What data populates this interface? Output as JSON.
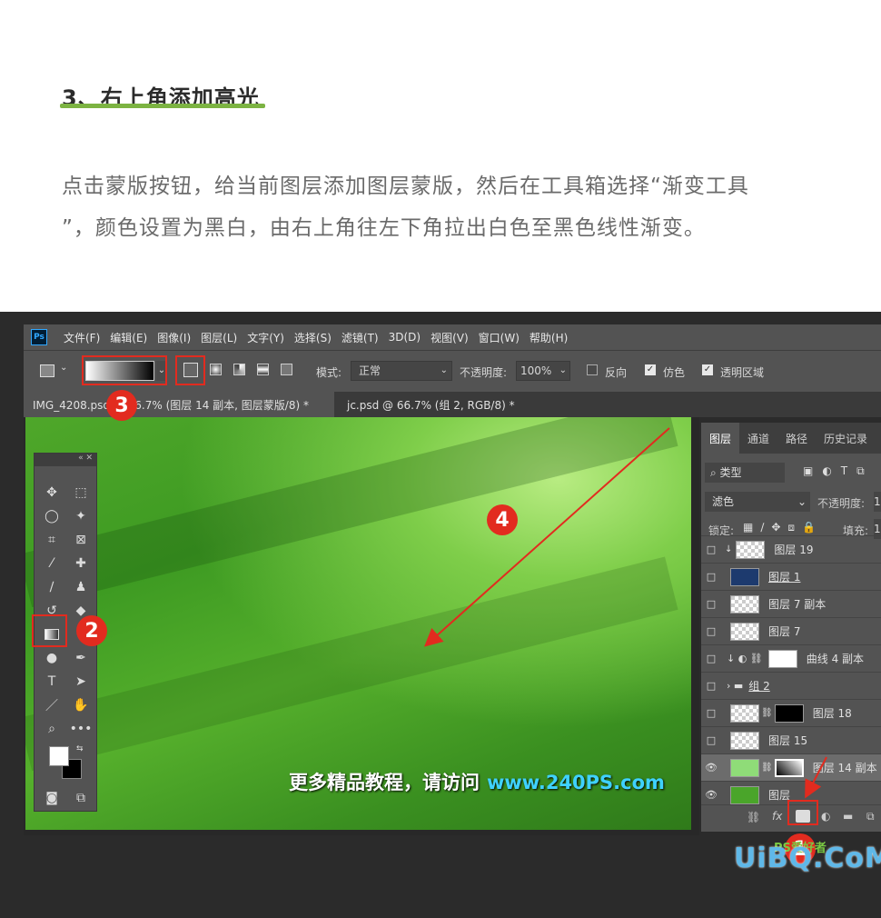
{
  "article": {
    "step_title": "3、右上角添加高光",
    "body_line1": "点击蒙版按钮，给当前图层添加图层蒙版，然后在工具箱选择“渐变工具",
    "body_line2": "”，颜色设置为黑白，由右上角往左下角拉出白色至黑色线性渐变。"
  },
  "menubar": {
    "logo": "Ps",
    "items": [
      "文件(F)",
      "编辑(E)",
      "图像(I)",
      "图层(L)",
      "文字(Y)",
      "选择(S)",
      "滤镜(T)",
      "3D(D)",
      "视图(V)",
      "窗口(W)",
      "帮助(H)"
    ]
  },
  "options": {
    "mode_label": "模式:",
    "mode_value": "正常",
    "opacity_label": "不透明度:",
    "opacity_value": "100%",
    "reverse_label": "反向",
    "dither_label": "仿色",
    "transparency_label": "透明区域"
  },
  "tabs": {
    "active": "IMG_4208.psd @ 66.7% (图层 14 副本, 图层蒙版/8) *",
    "inactive": "jc.psd @ 66.7% (组 2, RGB/8) *"
  },
  "watermark": {
    "text": "更多精品教程，请访问",
    "url": "www.240PS.com"
  },
  "badges": {
    "b1": "1",
    "b2": "2",
    "b3": "3",
    "b4": "4"
  },
  "layers_panel": {
    "tabs": [
      "图层",
      "通道",
      "路径",
      "历史记录"
    ],
    "filter_label": "类型",
    "blend_mode": "滤色",
    "opacity_label": "不透明度:",
    "opacity_value": "1",
    "lock_label": "锁定:",
    "fill_label": "填充:",
    "fill_value": "1",
    "layers": [
      {
        "name": "图层 19"
      },
      {
        "name": "图层 1"
      },
      {
        "name": "图层 7 副本"
      },
      {
        "name": "图层 7"
      },
      {
        "name": "曲线 4 副本"
      },
      {
        "name": "组 2"
      },
      {
        "name": "图层 18"
      },
      {
        "name": "图层 15"
      },
      {
        "name": "图层 14 副本"
      },
      {
        "name": "图层"
      }
    ]
  },
  "corner_logo": {
    "main": "UiBQ.CoM",
    "sub": "PS爱好者"
  },
  "colors": {
    "badge": "#e22b1f",
    "accent_underline": "#7cb342",
    "url": "#3fd2ff"
  }
}
